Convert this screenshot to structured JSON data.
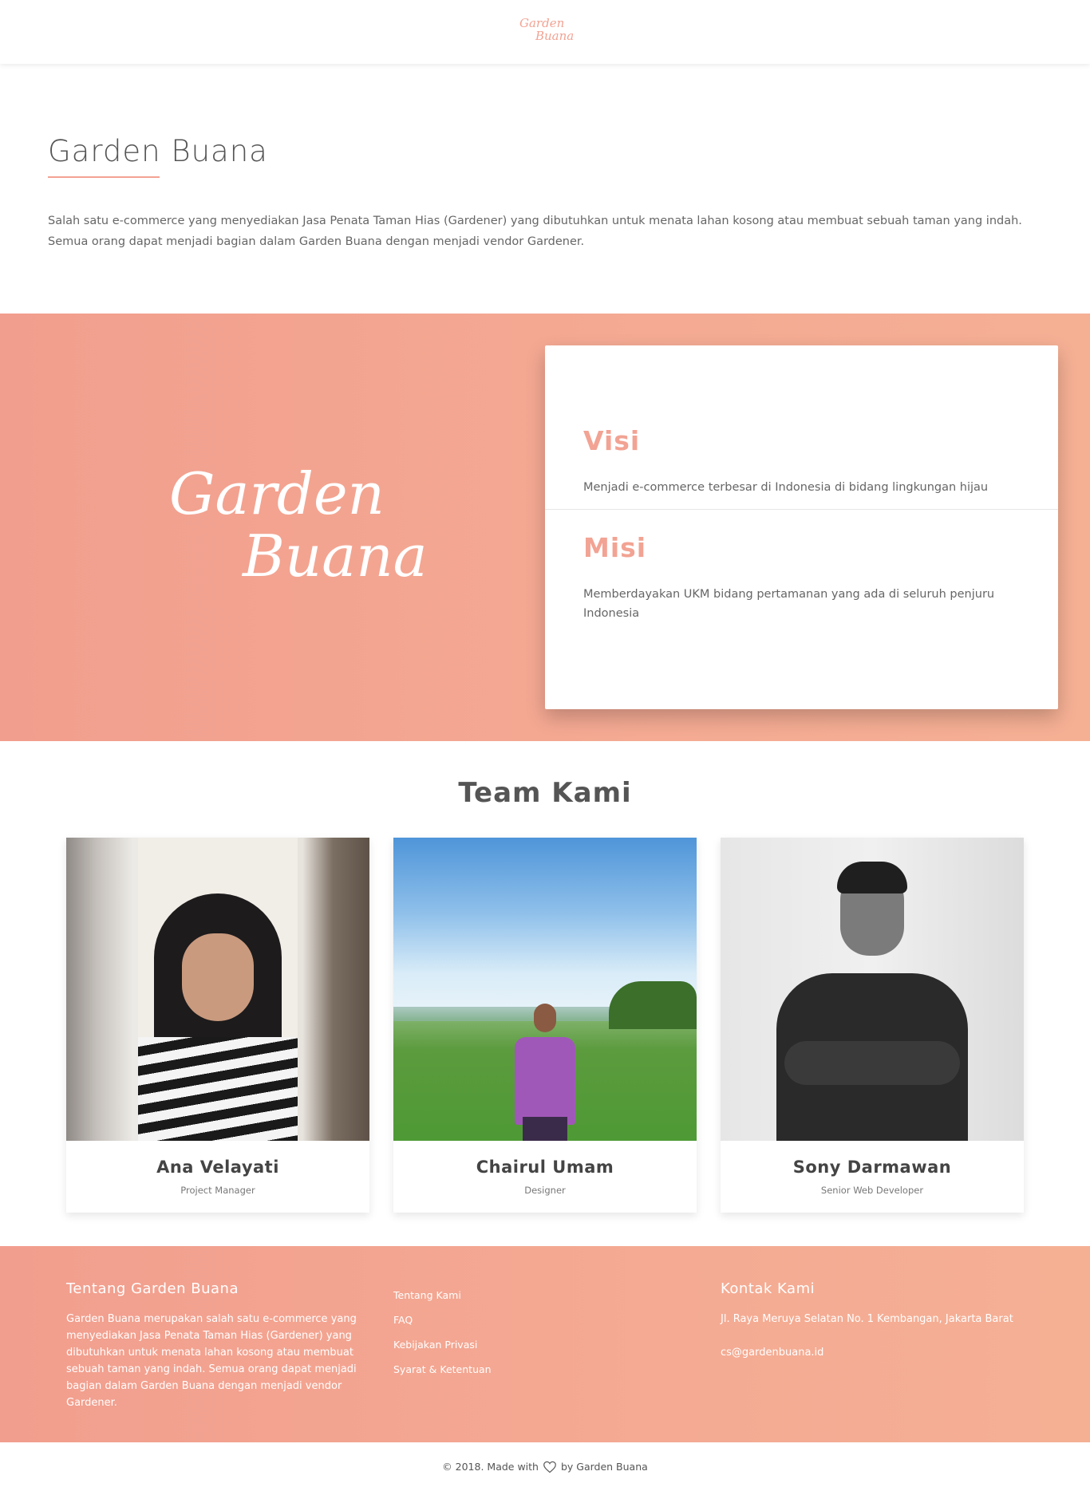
{
  "header": {
    "logo_line1": "Garden",
    "logo_line2": "Buana"
  },
  "intro": {
    "title": "Garden Buana",
    "text": "Salah satu e-commerce yang menyediakan Jasa Penata Taman Hias (Gardener) yang dibutuhkan untuk menata lahan kosong atau membuat sebuah taman yang indah. Semua orang dapat menjadi bagian dalam Garden Buana dengan menjadi vendor Gardener."
  },
  "hero": {
    "logo_line1": "Garden",
    "logo_line2": "Buana",
    "visi_heading": "Visi",
    "visi_text": "Menjadi e-commerce terbesar di Indonesia di bidang lingkungan hijau",
    "misi_heading": "Misi",
    "misi_text": "Memberdayakan UKM bidang pertamanan yang ada di seluruh penjuru Indonesia"
  },
  "team": {
    "title": "Team Kami",
    "members": [
      {
        "name": "Ana Velayati",
        "role": "Project Manager"
      },
      {
        "name": "Chairul Umam",
        "role": "Designer"
      },
      {
        "name": "Sony Darmawan",
        "role": "Senior Web Developer"
      }
    ]
  },
  "footer": {
    "about_heading": "Tentang Garden Buana",
    "about_text": "Garden Buana merupakan salah satu e-commerce yang menyediakan Jasa Penata Taman Hias (Gardener) yang dibutuhkan untuk menata lahan kosong atau membuat sebuah taman yang indah. Semua orang dapat menjadi bagian dalam Garden Buana dengan menjadi vendor Gardener.",
    "links": [
      "Tentang Kami",
      "FAQ",
      "Kebijakan Privasi",
      "Syarat & Ketentuan"
    ],
    "contact_heading": "Kontak Kami",
    "address": "Jl. Raya Meruya Selatan No. 1 Kembangan, Jakarta Barat",
    "email": "cs@gardenbuana.id"
  },
  "copyright": {
    "prefix": "© 2018. Made with",
    "suffix": "by Garden Buana"
  },
  "colors": {
    "accent": "#f2a393",
    "gradient_start": "#f29e8e",
    "gradient_end": "#f5b094"
  },
  "icons": {
    "heart": "heart-icon"
  }
}
